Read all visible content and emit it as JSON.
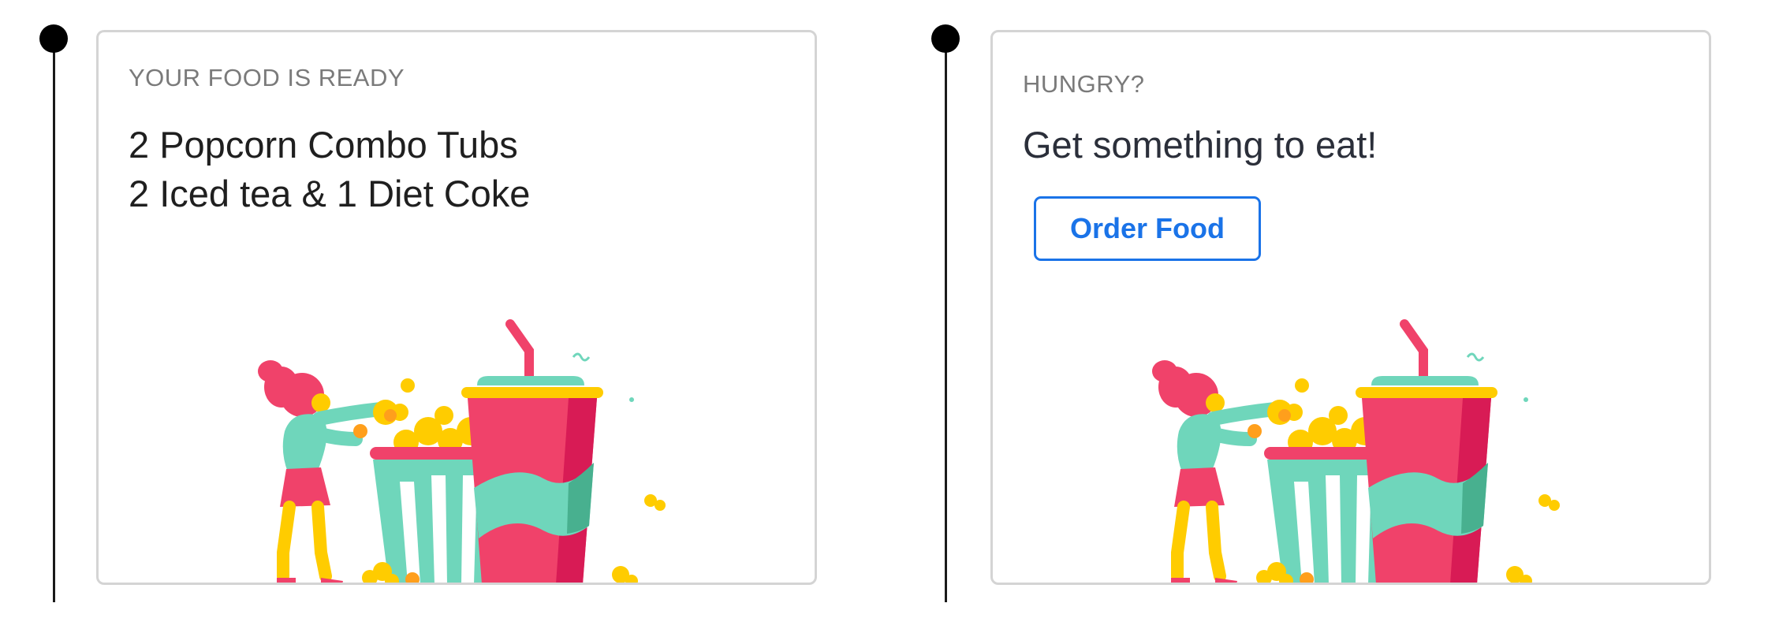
{
  "timeline": {
    "items": [
      {
        "eyebrow": "YOUR FOOD IS READY",
        "title_lines": [
          "2 Popcorn Combo Tubs",
          "2 Iced tea & 1 Diet Coke"
        ],
        "illustration_icon": "popcorn-combo-illustration"
      },
      {
        "eyebrow": "HUNGRY?",
        "title_lines": [
          "Get something to eat!"
        ],
        "button_label": "Order Food",
        "illustration_icon": "popcorn-combo-illustration"
      }
    ]
  },
  "colors": {
    "accent": "#1a73e8",
    "timeline": "#000000",
    "card_border": "#d4d4d4",
    "illustration_pink": "#f0426a",
    "illustration_teal": "#6fd6bb",
    "illustration_yellow": "#ffcc00"
  }
}
